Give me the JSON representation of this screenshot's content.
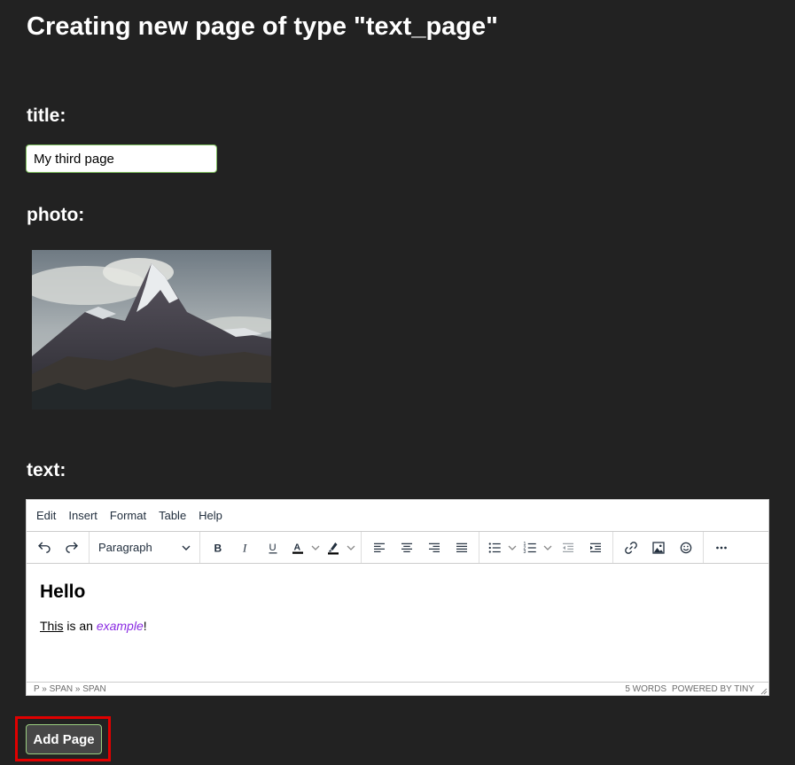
{
  "page": {
    "heading": "Creating new page of type \"text_page\""
  },
  "form": {
    "title_label": "title:",
    "title_value": "My third page",
    "photo_label": "photo:",
    "text_label": "text:",
    "submit_label": "Add Page"
  },
  "editor": {
    "menu": [
      "Edit",
      "Insert",
      "Format",
      "Table",
      "Help"
    ],
    "block_format": "Paragraph",
    "toolbar_icons": [
      "undo-icon",
      "redo-icon",
      "bold-icon",
      "italic-icon",
      "underline-icon",
      "text-color-icon",
      "highlight-color-icon",
      "align-left-icon",
      "align-center-icon",
      "align-right-icon",
      "align-justify-icon",
      "bullet-list-icon",
      "numbered-list-icon",
      "outdent-icon",
      "indent-icon",
      "link-icon",
      "image-icon",
      "emoji-icon",
      "more-icon"
    ],
    "content": {
      "heading": "Hello",
      "p_underlined": "This",
      "p_middle": " is an ",
      "p_italic": "example",
      "p_end": "!"
    },
    "status_path": "P » SPAN » SPAN",
    "word_count": "5 WORDS",
    "powered_by": "POWERED BY TINY"
  },
  "colors": {
    "background": "#222222",
    "highlight_border": "#e00000",
    "input_border": "#7fbf5f",
    "italic_text": "#8a2be2"
  }
}
